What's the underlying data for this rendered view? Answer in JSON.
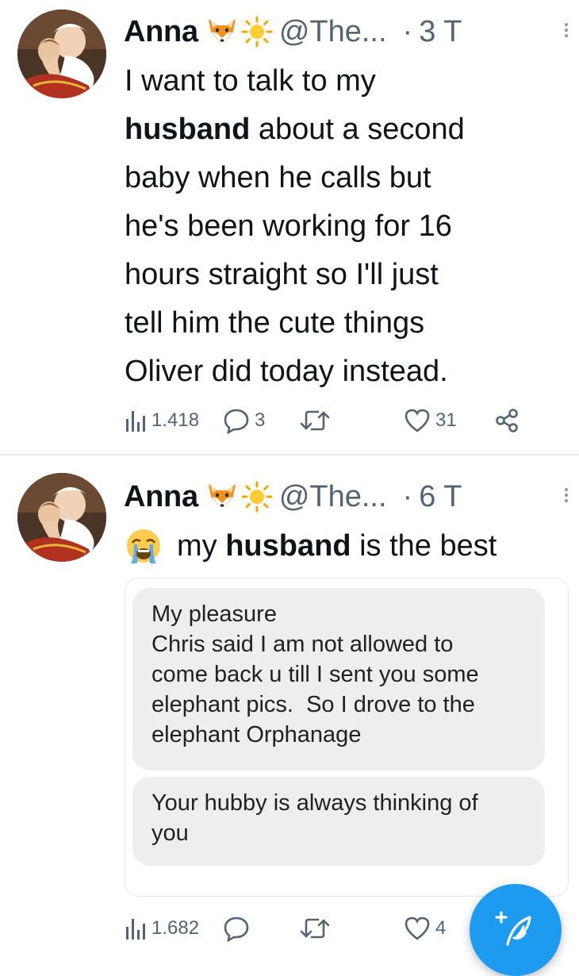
{
  "tweets": [
    {
      "name": "Anna",
      "handle": "@The...",
      "dot": "·",
      "time": "3 T",
      "text_lines": [
        [
          "I want to talk to my",
          ""
        ],
        [
          "",
          "husband",
          " about a second"
        ],
        [
          "baby when he calls but"
        ],
        [
          "he's been working for 16"
        ],
        [
          "hours straight so I'll just"
        ],
        [
          "tell him the cute things"
        ],
        [
          "Oliver did today instead."
        ]
      ],
      "line1": "I want to talk to my",
      "line2_bold": "husband",
      "line2_rest": " about a second",
      "line3": "baby when he calls but",
      "line4": "he's been working for 16",
      "line5": "hours straight so I'll just",
      "line6": "tell him the cute things",
      "line7": "Oliver did today instead.",
      "views": "1.418",
      "replies": "3",
      "retweets": "",
      "likes": "31"
    },
    {
      "name": "Anna",
      "handle": "@The...",
      "dot": "·",
      "time": "6 T",
      "text_plain": "my ",
      "text_bold": "husband",
      "text_rest": " is the best",
      "emoji": "loudly-crying-face",
      "views": "1.682",
      "replies": "",
      "retweets": "",
      "likes": "4",
      "media": {
        "bubble1": [
          "My pleasure",
          "Chris said I am not allowed to",
          "come back u till I sent you some",
          "elephant pics.  So I drove to the",
          "elephant Orphanage"
        ],
        "bubble2": [
          "Your hubby is always thinking of",
          "you"
        ]
      }
    }
  ],
  "icons": {
    "fox": "fox-face-emoji",
    "sun": "sun-emoji",
    "views": "bar-chart-icon",
    "reply": "speech-bubble-icon",
    "retweet": "retweet-icon",
    "like": "heart-icon",
    "share": "share-icon",
    "compose": "feather-plus-icon"
  },
  "colors": {
    "accent": "#1d9bf0",
    "secondary_text": "#536471",
    "divider": "#e7e9ea",
    "bubble": "#eeeeee"
  }
}
